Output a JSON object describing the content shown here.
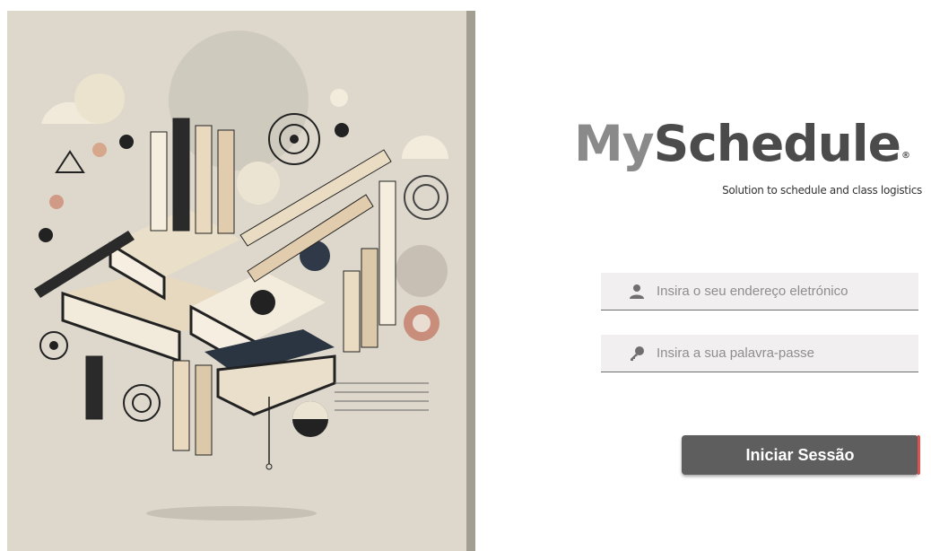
{
  "brand": {
    "my": "My",
    "schedule": "Schedule",
    "registered": "®",
    "tagline": "Solution to schedule and class logistics"
  },
  "login": {
    "email_placeholder": "Insira o seu endereço eletrónico",
    "password_placeholder": "Insira a sua palavra-passe",
    "submit_label": "Iniciar Sessão"
  },
  "icons": {
    "email": "user-icon",
    "password": "key-icon"
  },
  "colors": {
    "button_bg": "#5e5e5e",
    "button_accent": "#d9534f",
    "logo_light": "#8a8a8a",
    "logo_dark": "#4b4b4b",
    "hero_bg": "#ddd8cb"
  }
}
